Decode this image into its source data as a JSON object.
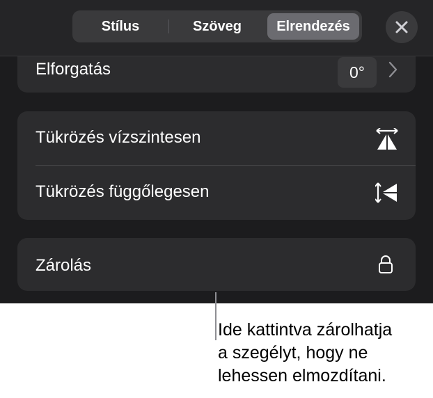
{
  "header": {
    "tabs": [
      "Stílus",
      "Szöveg",
      "Elrendezés"
    ],
    "selected_tab": "Elrendezés",
    "close_icon": "close-icon"
  },
  "rotation": {
    "label": "Elforgatás",
    "value": "0°",
    "chevron_icon": "chevron-right-icon"
  },
  "flip": {
    "horizontal_label": "Tükrözés vízszintesen",
    "horizontal_icon": "flip-horizontal-icon",
    "vertical_label": "Tükrözés függőlegesen",
    "vertical_icon": "flip-vertical-icon"
  },
  "lock": {
    "label": "Zárolás",
    "icon": "lock-icon"
  },
  "callout": {
    "lines": [
      "Ide kattintva zárolhatja",
      "a szegélyt, hogy ne",
      "lehessen elmozdítani."
    ]
  },
  "colors": {
    "panel_background": "#1c1c1e",
    "group_background": "#2c2c2e",
    "segment_background": "#3a3a3c",
    "selected_segment": "#6b6b70",
    "text": "#ffffff"
  }
}
